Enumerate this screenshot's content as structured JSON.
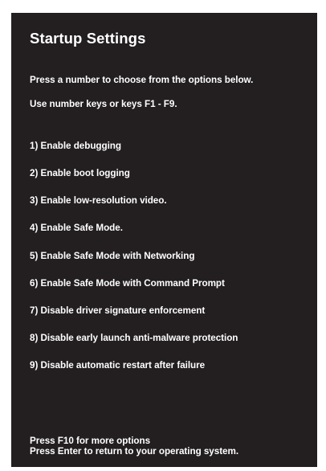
{
  "screen": {
    "title": "Startup Settings",
    "instructions": [
      "Press a number to choose from the options below.",
      "Use number keys or keys F1 - F9."
    ],
    "options": [
      "1) Enable debugging",
      "2) Enable boot logging",
      "3) Enable low-resolution video.",
      "4) Enable Safe Mode.",
      "5) Enable Safe Mode with Networking",
      "6) Enable Safe Mode with Command Prompt",
      "7) Disable driver signature enforcement",
      "8) Disable early launch anti-malware protection",
      "9) Disable automatic restart after failure"
    ],
    "footer": {
      "more_options": "Press F10 for more options",
      "return_os": "Press Enter to return to your operating system."
    },
    "colors": {
      "background": "#231f20",
      "text": "#ffffff"
    }
  }
}
